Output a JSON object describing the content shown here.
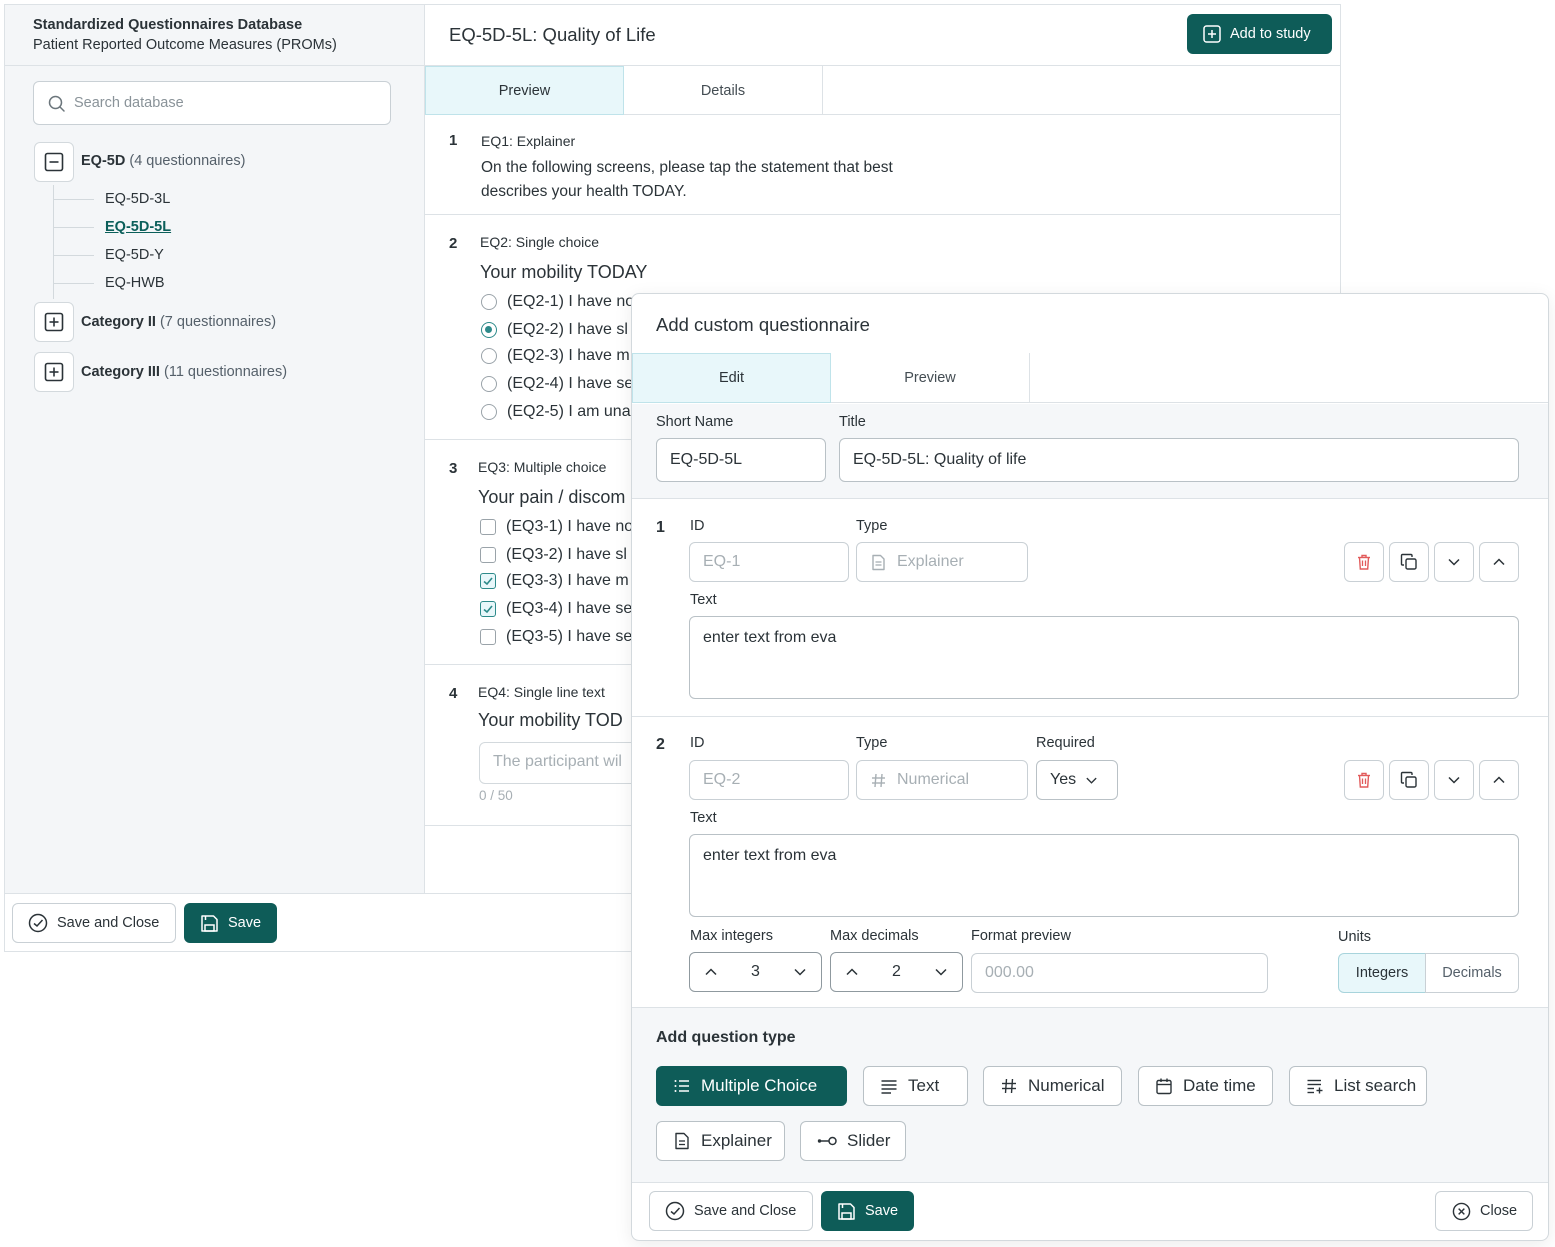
{
  "sidebar": {
    "db_title": "Standardized Questionnaires Database",
    "db_subtitle": "Patient Reported Outcome Measures (PROMs)",
    "search_placeholder": "Search database",
    "groups": [
      {
        "name": "EQ-5D",
        "count": "(4 questionnaires)",
        "expanded": true,
        "children": [
          "EQ-5D-3L",
          "EQ-5D-5L",
          "EQ-5D-Y",
          "EQ-HWB"
        ],
        "active_child": "EQ-5D-5L"
      },
      {
        "name": "Category II",
        "count": "(7 questionnaires)",
        "expanded": false
      },
      {
        "name": "Category III",
        "count": "(11 questionnaires)",
        "expanded": false
      }
    ]
  },
  "main": {
    "title": "EQ-5D-5L: Quality of Life",
    "add_to_study": "Add to study",
    "tabs": [
      "Preview",
      "Details"
    ],
    "active_tab": "Preview",
    "questions": [
      {
        "num": "1",
        "meta": "EQ1:  Explainer",
        "text_lines": [
          "On the following screens, please tap the statement that best",
          "describes your health TODAY."
        ]
      },
      {
        "num": "2",
        "meta": "EQ2:  Single choice",
        "heading": "Your mobility TODAY",
        "options": [
          "(EQ2-1) I have no",
          "(EQ2-2) I have sl",
          "(EQ2-3) I have m",
          "(EQ2-4) I have se",
          "(EQ2-5) I am una"
        ],
        "selected": [
          1
        ]
      },
      {
        "num": "3",
        "meta": "EQ3:  Multiple choice",
        "heading": "Your pain / discom",
        "options": [
          "(EQ3-1) I have no",
          "(EQ3-2) I have sl",
          "(EQ3-3) I have m",
          "(EQ3-4) I have se",
          "(EQ3-5) I have se"
        ],
        "selected": [
          2,
          3
        ]
      },
      {
        "num": "4",
        "meta": "EQ4:  Single line text",
        "heading": "Your mobility TOD",
        "input_placeholder": "The participant wil",
        "counter": "0 / 50"
      }
    ]
  },
  "footer": {
    "save_and_close": "Save and Close",
    "save": "Save"
  },
  "modal": {
    "title": "Add custom questionnaire",
    "tabs": [
      "Edit",
      "Preview"
    ],
    "active_tab": "Edit",
    "short_name_label": "Short Name",
    "short_name_value": "EQ-5D-5L",
    "title_label": "Title",
    "title_value": "EQ-5D-5L: Quality of life",
    "items": [
      {
        "num": "1",
        "id_label": "ID",
        "id_value": "EQ-1",
        "type_label": "Type",
        "type_value": "Explainer",
        "text_label": "Text",
        "text_value": "enter text from eva"
      },
      {
        "num": "2",
        "id_label": "ID",
        "id_value": "EQ-2",
        "type_label": "Type",
        "type_value": "Numerical",
        "required_label": "Required",
        "required_value": "Yes",
        "text_label": "Text",
        "text_value": "enter text from eva",
        "max_integers_label": "Max integers",
        "max_integers": "3",
        "max_decimals_label": "Max decimals",
        "max_decimals": "2",
        "format_preview_label": "Format preview",
        "format_preview": "000.00",
        "units_label": "Units",
        "units_options": [
          "Integers",
          "Decimals"
        ],
        "units_selected": "Integers"
      }
    ],
    "add_question_type_label": "Add question type",
    "question_types": [
      "Multiple Choice",
      "Text",
      "Numerical",
      "Date time",
      "List search",
      "Explainer",
      "Slider"
    ],
    "active_question_type": "Multiple Choice",
    "footer": {
      "save_and_close": "Save and Close",
      "save": "Save",
      "close": "Close"
    }
  },
  "colors": {
    "brand": "#0e5c58",
    "tab_active_bg": "#e8f7fa",
    "delete": "#e25b5b"
  }
}
